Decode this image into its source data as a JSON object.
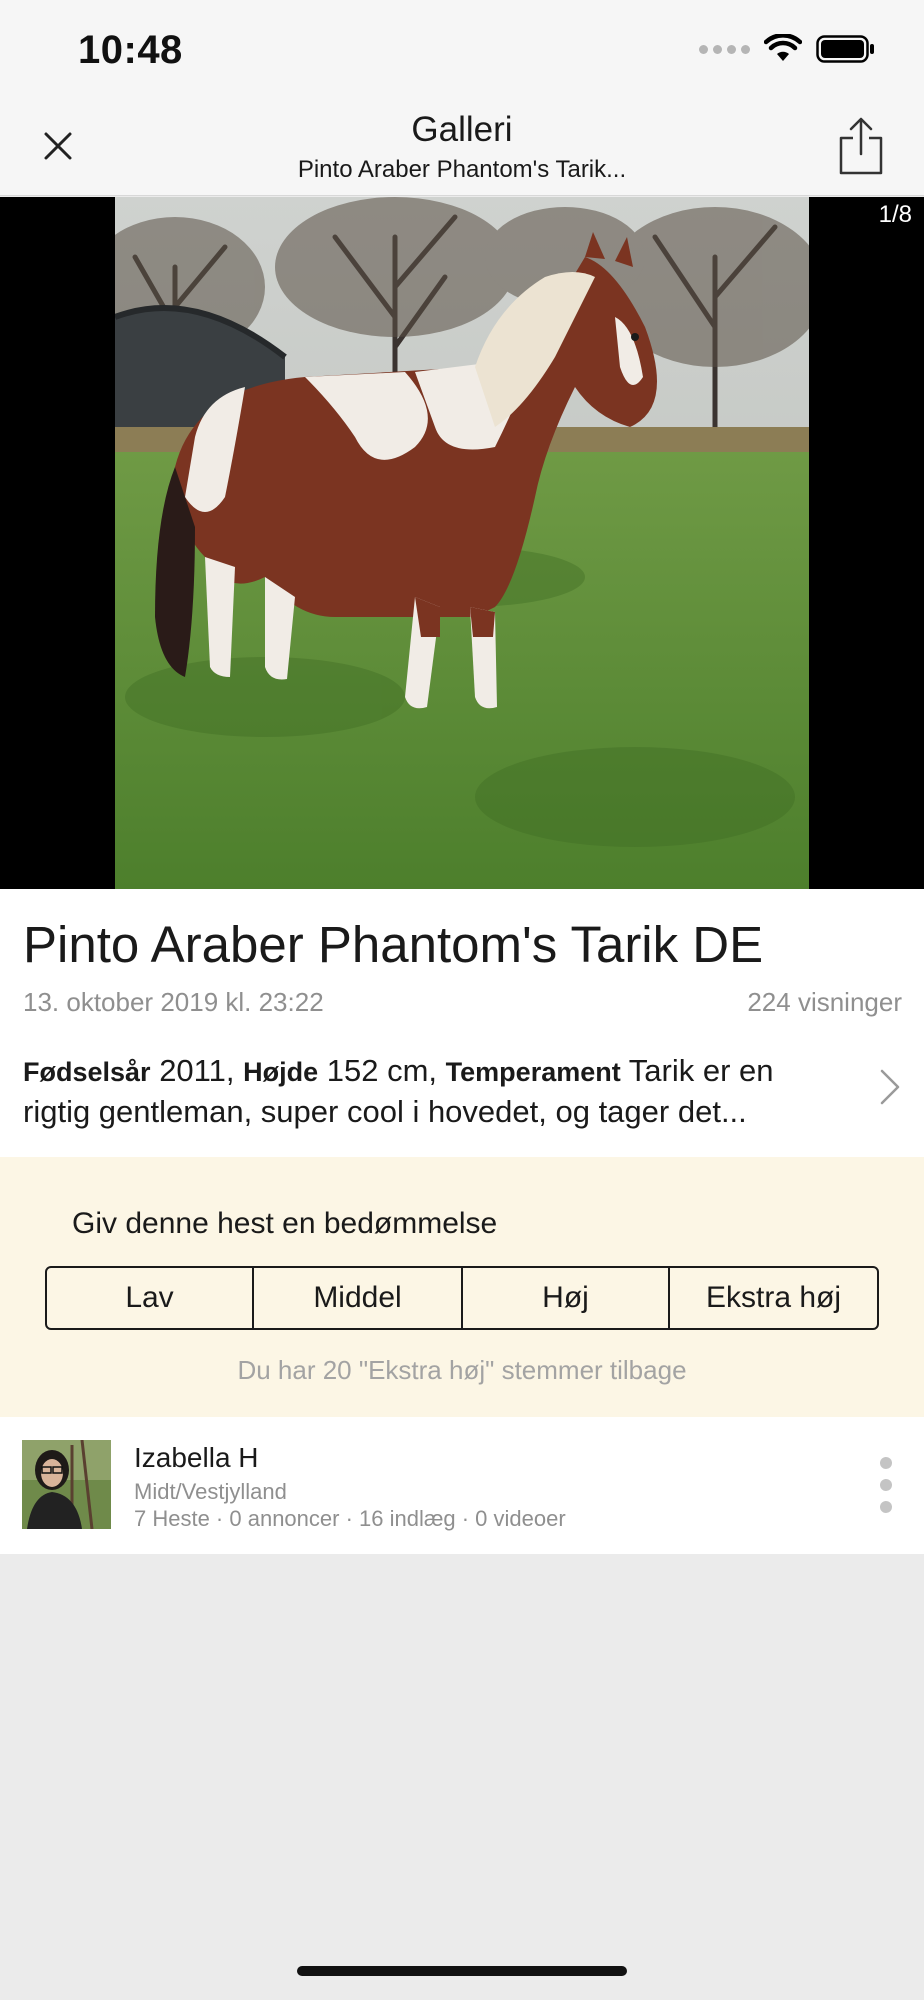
{
  "status_bar": {
    "time": "10:48",
    "icons": [
      "cellular-signal-icon",
      "wifi-icon",
      "battery-icon"
    ]
  },
  "nav": {
    "title": "Galleri",
    "subtitle": "Pinto Araber Phantom's Tarik...",
    "close_icon": "close-icon",
    "share_icon": "share-icon"
  },
  "gallery": {
    "counter": "1/8"
  },
  "horse": {
    "title": "Pinto Araber Phantom's Tarik DE",
    "date": "13. oktober 2019 kl. 23:22",
    "views": "224 visninger",
    "description": {
      "birth_year_label": "Fødselsår",
      "birth_year_value": "2011",
      "sep1": ",",
      "height_label": "Højde",
      "height_value": "152 cm",
      "sep2": ",",
      "temperament_label": "Temperament",
      "temperament_value_line1": "Tarik er en",
      "line2": "rigtig gentleman, super cool i hovedet, og tager det..."
    }
  },
  "rating": {
    "heading": "Giv denne hest en bedømmelse",
    "options": [
      "Lav",
      "Middel",
      "Høj",
      "Ekstra høj"
    ],
    "note": "Du har 20 \"Ekstra høj\" stemmer tilbage"
  },
  "owner": {
    "name": "Izabella H",
    "region": "Midt/Vestjylland",
    "stats": "7 Heste · 0 annoncer · 16 indlæg · 0 videoer"
  },
  "colors": {
    "rating_background": "#fcf6e5",
    "bar_background": "#f6f6f6",
    "page_background": "#ebebeb"
  }
}
